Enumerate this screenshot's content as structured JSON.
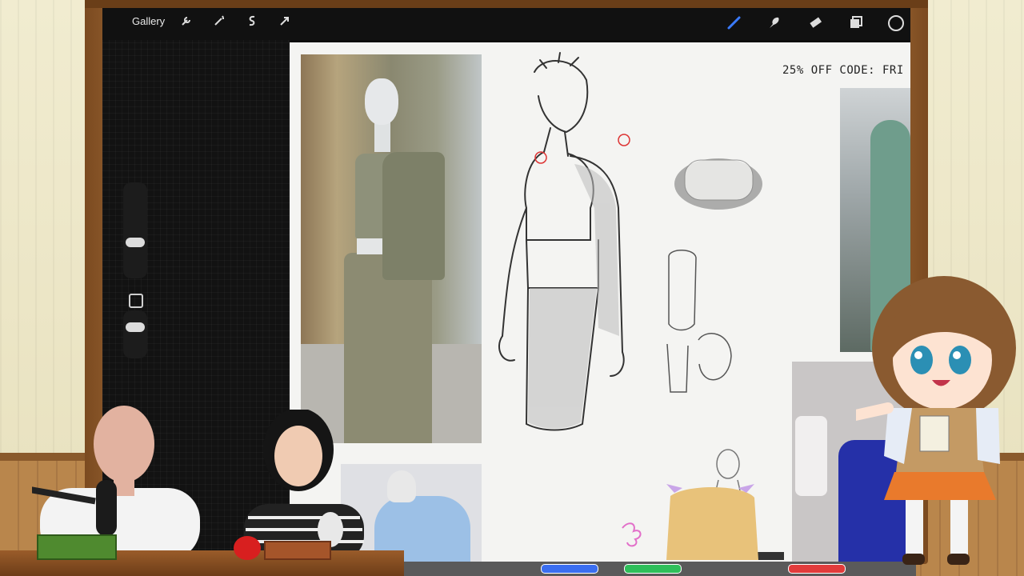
{
  "toolbar": {
    "gallery_label": "Gallery",
    "left_tools": [
      "wrench-icon",
      "magic-wand-icon",
      "selection-icon",
      "transform-arrow-icon"
    ],
    "right_tools": [
      "brush-icon",
      "smudge-icon",
      "eraser-icon",
      "layers-icon",
      "color-swatch-icon"
    ],
    "brush_color": "#3a7bff"
  },
  "canvas": {
    "promo_text": "25% OFF CODE: FRI"
  },
  "colors": {
    "frame_wood": "#a8723c",
    "wallpaper": "#efe9c8",
    "canvas": "#f4f4f2",
    "accent_markers": [
      "#3a6ef0",
      "#2fbf5a",
      "#e23b3b"
    ]
  }
}
